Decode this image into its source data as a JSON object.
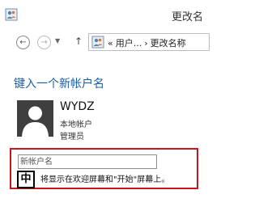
{
  "window": {
    "title": "更改名",
    "app_icon": "users-icon"
  },
  "navigation": {
    "back_icon": "←",
    "forward_icon": "→",
    "dropdown_icon": "▼",
    "up_icon": "↑",
    "address": {
      "prefix": "«",
      "crumb1": "用户...",
      "separator": "›",
      "crumb2": "更改名称"
    }
  },
  "main": {
    "heading": "键入一个新帐户名",
    "account": {
      "name": "WYDZ",
      "type": "本地帐户",
      "role": "管理员"
    },
    "new_name_input": {
      "placeholder": "新帐户名",
      "value": ""
    },
    "ime_indicator": "中",
    "hint": "将显示在欢迎屏幕和\"开始\"屏幕上。"
  },
  "colors": {
    "heading": "#1a5ea8",
    "highlight_border": "#c8141d",
    "avatar_bg": "#3f3f3f"
  }
}
